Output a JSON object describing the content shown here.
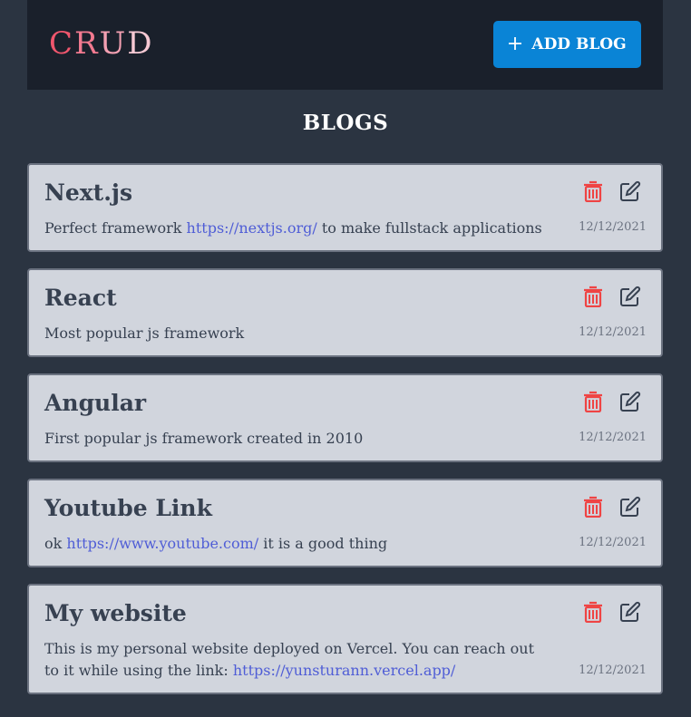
{
  "header": {
    "logo_letters": [
      "C",
      "R",
      "U",
      "D"
    ],
    "logo_colors": [
      "#f0566d",
      "#f27a90",
      "#f4a0b2",
      "#f7c9d4"
    ],
    "add_button_label": "ADD BLOG",
    "add_button_icon": "plus-icon"
  },
  "page": {
    "title": "BLOGS"
  },
  "colors": {
    "accent": "#0a84d6",
    "trash": "#ef4444",
    "link": "#4f5dd6"
  },
  "blogs": [
    {
      "title": "Next.js",
      "body_pre": "Perfect framework ",
      "link": "https://nextjs.org/",
      "body_post": " to make fullstack applications",
      "date": "12/12/2021"
    },
    {
      "title": "React",
      "body_pre": "Most popular js framework",
      "link": "",
      "body_post": "",
      "date": "12/12/2021"
    },
    {
      "title": "Angular",
      "body_pre": "First popular js framework created in 2010",
      "link": "",
      "body_post": "",
      "date": "12/12/2021"
    },
    {
      "title": "Youtube Link",
      "body_pre": "ok ",
      "link": "https://www.youtube.com/",
      "body_post": " it is a good thing",
      "date": "12/12/2021"
    },
    {
      "title": "My website",
      "body_pre": "This is my personal website deployed on Vercel. You can reach out to it while using the link: ",
      "link": "https://yunsturann.vercel.app/",
      "body_post": "",
      "date": "12/12/2021"
    }
  ]
}
